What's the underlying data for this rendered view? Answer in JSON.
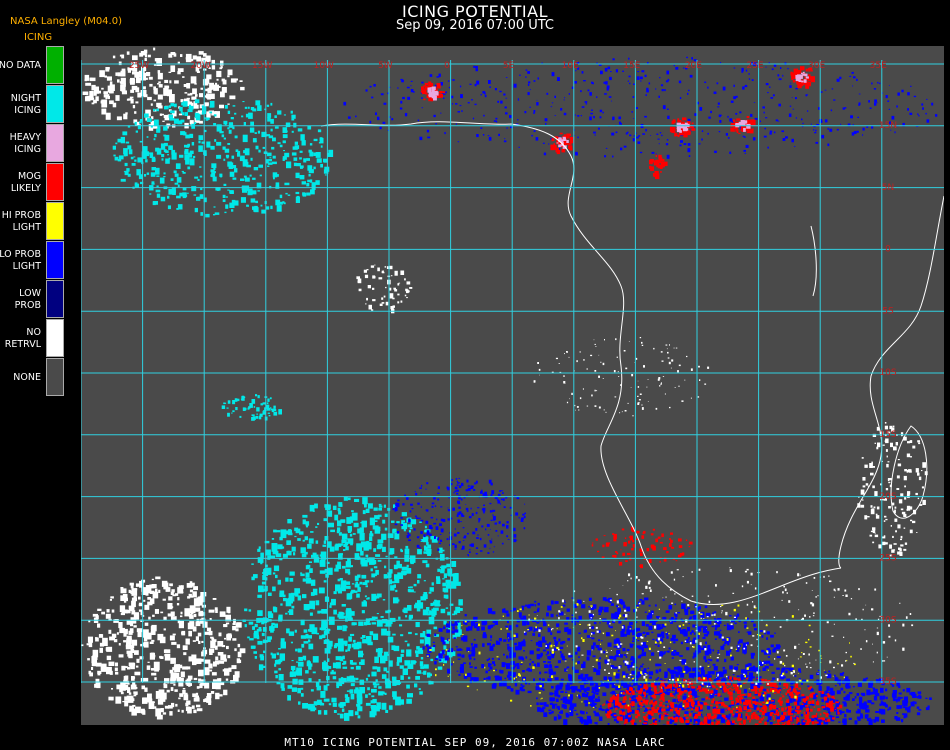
{
  "header": {
    "title": "ICING POTENTIAL",
    "datetime": "Sep 09, 2016 07:00 UTC",
    "source": "NASA Langley (M04.0)"
  },
  "legend": {
    "title": "ICING",
    "items": [
      {
        "line1": "NO DATA",
        "line2": "",
        "color": "#00b000"
      },
      {
        "line1": "NIGHT",
        "line2": "ICING",
        "color": "#00e8e8"
      },
      {
        "line1": "HEAVY",
        "line2": "ICING",
        "color": "#e8a8e0"
      },
      {
        "line1": "MOG",
        "line2": "LIKELY",
        "color": "#ff0000"
      },
      {
        "line1": "HI PROB",
        "line2": "LIGHT",
        "color": "#ffff00"
      },
      {
        "line1": "LO PROB",
        "line2": "LIGHT",
        "color": "#0000ff"
      },
      {
        "line1": "LOW",
        "line2": "PROB",
        "color": "#000080"
      },
      {
        "line1": "NO",
        "line2": "RETRVL",
        "color": "#ffffff"
      },
      {
        "line1": "NONE",
        "line2": "",
        "color": "#4a4a4a"
      }
    ]
  },
  "map": {
    "background_color": "#4a4a4a",
    "grid_color": "#30d0e0",
    "coast_color": "#ffffff",
    "lon_labels": [
      "25W",
      "20W",
      "15W",
      "10W",
      "5W",
      "0",
      "5E",
      "10E",
      "15E",
      "20E",
      "25E",
      "30E",
      "35E"
    ],
    "lat_labels": [
      "15N",
      "5N",
      "0",
      "5S",
      "10S",
      "15S",
      "20S",
      "25S",
      "30S",
      "35S",
      "40S"
    ],
    "label_color": "#c02020"
  },
  "footer": {
    "text": "MT10  ICING POTENTIAL   SEP 09, 2016 07:00Z   NASA LARC"
  }
}
